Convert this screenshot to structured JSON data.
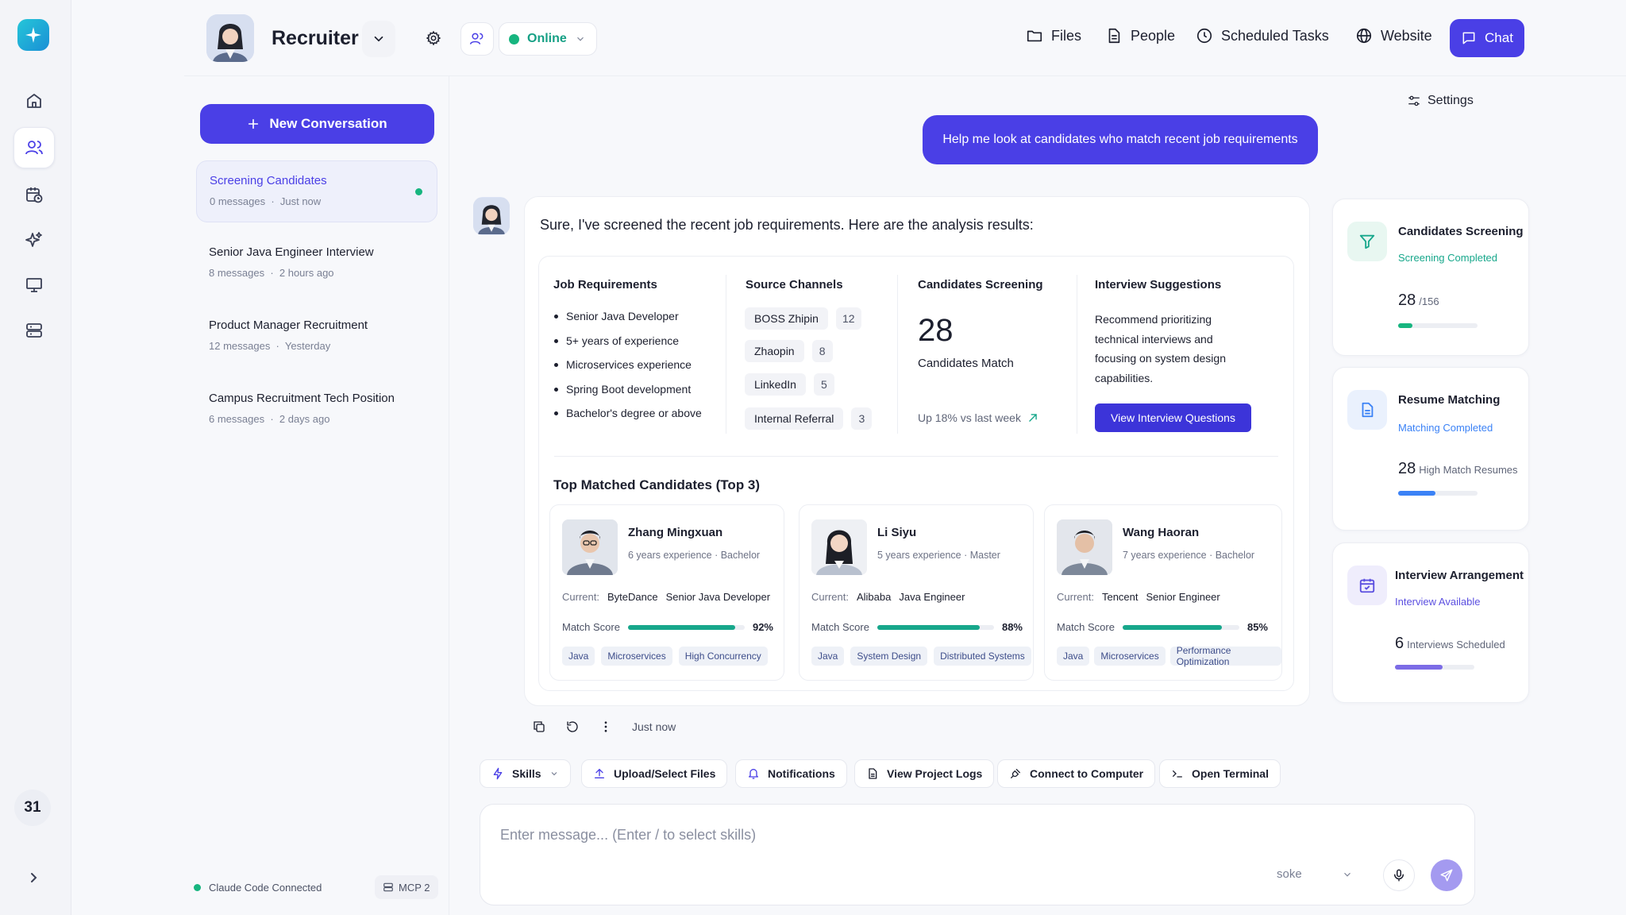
{
  "header": {
    "agent_name": "Recruiter",
    "status": "Online",
    "nav": [
      {
        "label": "Files",
        "icon": "folder-icon"
      },
      {
        "label": "People",
        "icon": "document-icon"
      },
      {
        "label": "Scheduled Tasks",
        "icon": "clock-icon"
      },
      {
        "label": "Website",
        "icon": "globe-icon"
      }
    ],
    "chat_label": "Chat"
  },
  "rail": {
    "day_badge": "31"
  },
  "sidebar": {
    "new_conversation": "New Conversation",
    "conversations": [
      {
        "title": "Screening Candidates",
        "messages": "0 messages",
        "time": "Just now",
        "active": true
      },
      {
        "title": "Senior Java Engineer Interview",
        "messages": "8 messages",
        "time": "2 hours ago"
      },
      {
        "title": "Product Manager Recruitment",
        "messages": "12 messages",
        "time": "Yesterday"
      },
      {
        "title": "Campus Recruitment Tech Position",
        "messages": "6 messages",
        "time": "2 days ago"
      }
    ],
    "footer_status": "Claude Code Connected",
    "mcp_label": "MCP 2"
  },
  "chat": {
    "settings_label": "Settings",
    "user_message": "Help me look at candidates who match recent job requirements",
    "reply_intro": "Sure, I've screened the recent job requirements. Here are the analysis results:",
    "columns": {
      "requirements_title": "Job Requirements",
      "requirements": [
        "Senior Java Developer",
        "5+ years of experience",
        "Microservices experience",
        "Spring Boot development",
        "Bachelor's degree or above"
      ],
      "channels_title": "Source Channels",
      "channels": [
        {
          "name": "BOSS Zhipin",
          "count": "12"
        },
        {
          "name": "Zhaopin",
          "count": "8"
        },
        {
          "name": "LinkedIn",
          "count": "5"
        },
        {
          "name": "Internal Referral",
          "count": "3"
        }
      ],
      "screening_title": "Candidates Screening",
      "screening_count": "28",
      "screening_label": "Candidates Match",
      "screening_trend": "Up 18% vs last week",
      "suggestions_title": "Interview Suggestions",
      "suggestions_text": "Recommend prioritizing technical interviews and focusing on system design capabilities.",
      "suggestions_button": "View Interview Questions"
    },
    "top_title": "Top Matched Candidates (Top 3)",
    "candidates": [
      {
        "name": "Zhang Mingxuan",
        "sub": "6 years experience · Bachelor",
        "current_label": "Current:",
        "company": "ByteDance",
        "role": "Senior Java Developer",
        "score_label": "Match Score",
        "score": 92,
        "score_text": "92%",
        "tags": [
          "Java",
          "Microservices",
          "High Concurrency"
        ]
      },
      {
        "name": "Li Siyu",
        "sub": "5 years experience · Master",
        "current_label": "Current:",
        "company": "Alibaba",
        "role": "Java Engineer",
        "score_label": "Match Score",
        "score": 88,
        "score_text": "88%",
        "tags": [
          "Java",
          "System Design",
          "Distributed Systems"
        ]
      },
      {
        "name": "Wang Haoran",
        "sub": "7 years experience · Bachelor",
        "current_label": "Current:",
        "company": "Tencent",
        "role": "Senior Engineer",
        "score_label": "Match Score",
        "score": 85,
        "score_text": "85%",
        "tags": [
          "Java",
          "Microservices",
          "Performance Optimization"
        ]
      }
    ],
    "message_time": "Just now"
  },
  "toolbar": {
    "items": [
      {
        "label": "Skills",
        "icon": "lightning-icon"
      },
      {
        "label": "Upload/Select Files",
        "icon": "upload-icon"
      },
      {
        "label": "Notifications",
        "icon": "bell-icon"
      },
      {
        "label": "View Project Logs",
        "icon": "log-icon"
      },
      {
        "label": "Connect to Computer",
        "icon": "plug-icon"
      },
      {
        "label": "Open Terminal",
        "icon": "terminal-icon"
      }
    ]
  },
  "composer": {
    "placeholder": "Enter message... (Enter / to select skills)",
    "model": "soke"
  },
  "stats": [
    {
      "title": "Candidates Screening",
      "status": "Screening Completed",
      "value": "28",
      "suffix": "/156",
      "fraction": 0.18,
      "color": "#17b57f",
      "status_color": "#17a78b",
      "icon": "filter-icon"
    },
    {
      "title": "Resume Matching",
      "status": "Matching Completed",
      "value": "28",
      "suffix": "High Match Resumes",
      "fraction": 0.47,
      "color": "#3b82f6",
      "status_color": "#3b82f6",
      "icon": "resume-icon"
    },
    {
      "title": "Interview Arrangement",
      "status": "Interview Available",
      "value": "6",
      "suffix": "Interviews Scheduled",
      "fraction": 0.6,
      "color": "#7c6ce6",
      "status_color": "#5b4fe0",
      "icon": "calendar-icon"
    }
  ]
}
